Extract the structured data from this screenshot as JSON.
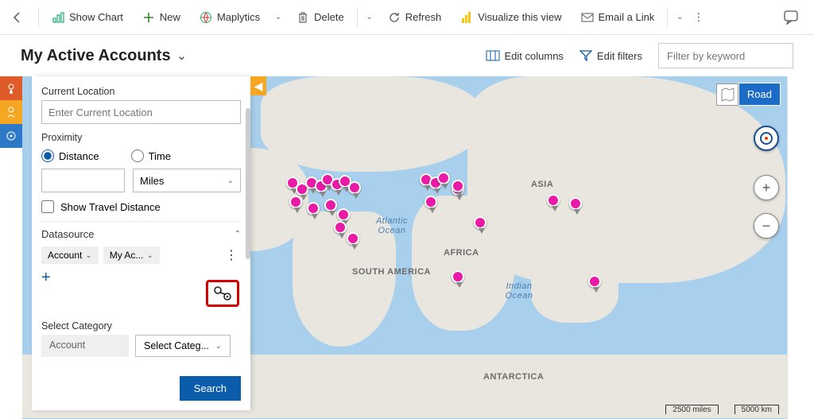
{
  "toolbar": {
    "show_chart": "Show Chart",
    "new": "New",
    "maplytics": "Maplytics",
    "delete": "Delete",
    "refresh": "Refresh",
    "visualize": "Visualize this view",
    "email_link": "Email a Link"
  },
  "header": {
    "view_title": "My Active Accounts",
    "edit_columns": "Edit columns",
    "edit_filters": "Edit filters",
    "search_placeholder": "Filter by keyword"
  },
  "panel": {
    "current_location_label": "Current Location",
    "current_location_placeholder": "Enter Current Location",
    "proximity_label": "Proximity",
    "distance_label": "Distance",
    "time_label": "Time",
    "unit": "Miles",
    "show_travel": "Show Travel Distance",
    "datasource_label": "Datasource",
    "chip_account": "Account",
    "chip_view": "My Ac...",
    "select_category_label": "Select Category",
    "cat_chip": "Account",
    "cat_select": "Select Categ...",
    "search_btn": "Search"
  },
  "map": {
    "type_label": "Road",
    "labels": {
      "asia": "ASIA",
      "africa": "AFRICA",
      "south_america": "SOUTH AMERICA",
      "antarctica": "ANTARCTICA",
      "atlantic": "Atlantic Ocean",
      "indian": "Indian Ocean"
    },
    "scale_miles": "2500 miles",
    "scale_km": "5000 km"
  },
  "icons": {
    "chart": "chart-icon",
    "plus": "plus-icon",
    "globe": "globe-icon",
    "trash": "trash-icon",
    "refresh": "refresh-icon",
    "visualize": "powerbi-icon",
    "mail": "mail-icon",
    "columns": "columns-icon",
    "filter": "filter-icon"
  }
}
